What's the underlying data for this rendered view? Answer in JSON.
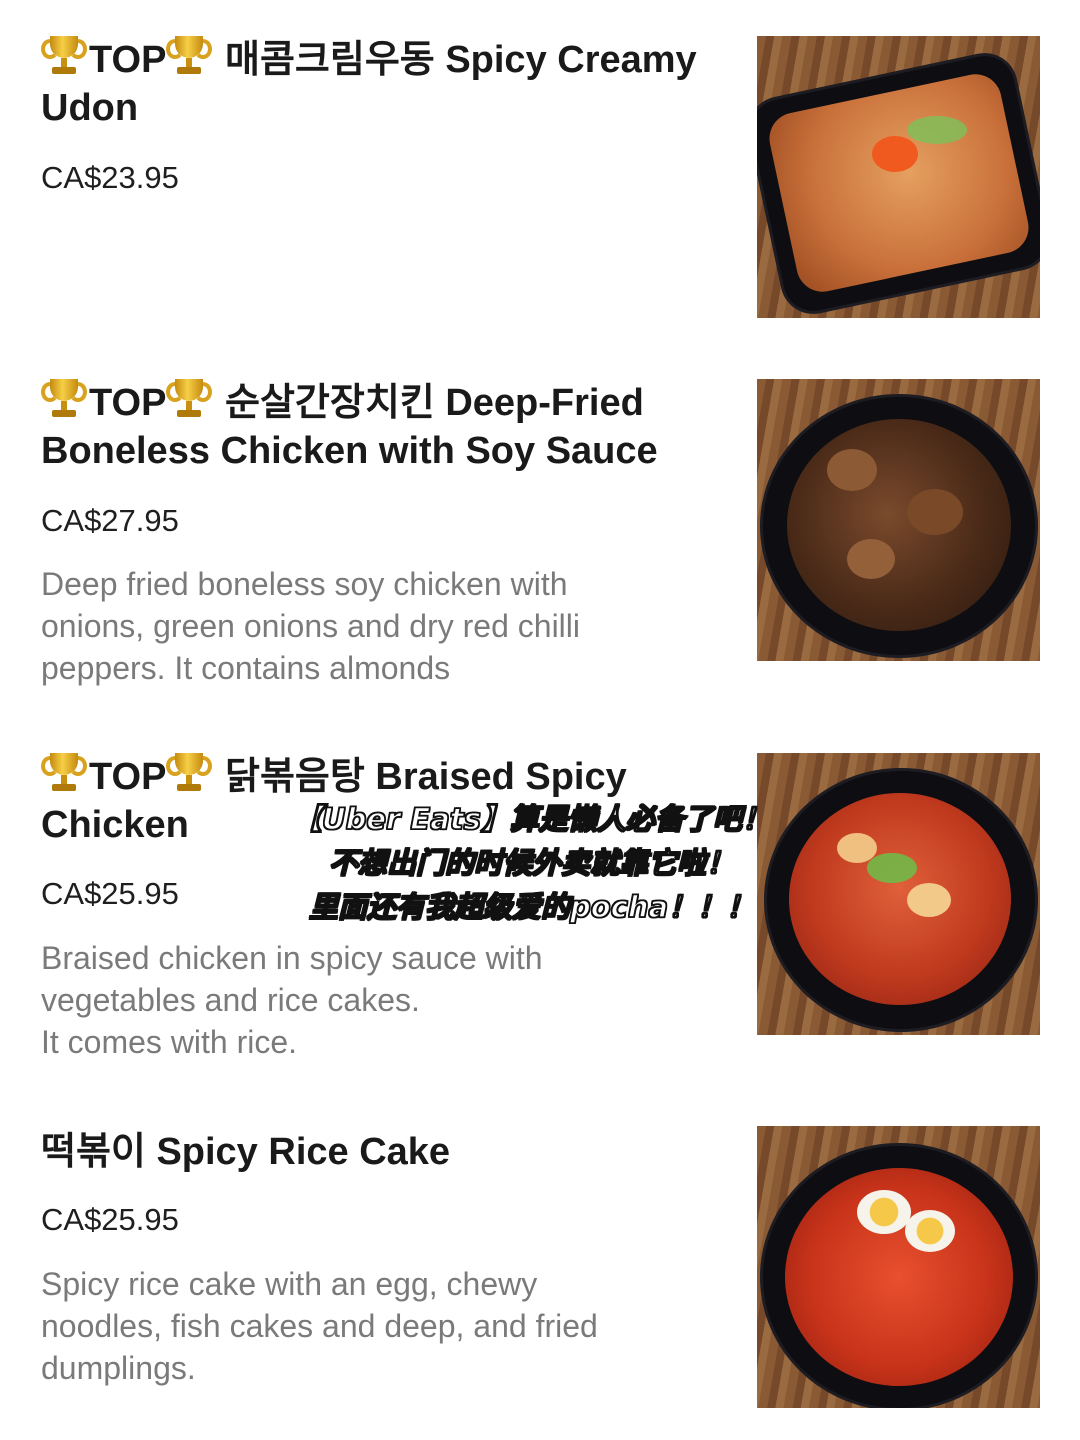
{
  "items": [
    {
      "top_badge": "TOP",
      "title": "매콤크림우동 Spicy Creamy Udon",
      "price": "CA$23.95",
      "description": "",
      "photo_icon": "spicy-creamy-udon-photo"
    },
    {
      "top_badge": "TOP",
      "title": "순살간장치킨 Deep-Fried Boneless Chicken with Soy Sauce",
      "price": "CA$27.95",
      "description": "Deep fried boneless soy chicken with\nonions, green onions and dry red chilli\npeppers. It contains almonds",
      "photo_icon": "soy-chicken-photo"
    },
    {
      "top_badge": "TOP",
      "title": "닭볶음탕 Braised Spicy Chicken",
      "price": "CA$25.95",
      "description": "Braised chicken in spicy sauce with\nvegetables and rice cakes.\nIt comes with rice.",
      "photo_icon": "braised-spicy-chicken-photo"
    },
    {
      "top_badge": "",
      "title": "떡볶이 Spicy Rice Cake",
      "price": "CA$25.95",
      "description": "Spicy rice cake with an egg, chewy\nnoodles, fish cakes and deep, and fried\ndumplings.",
      "photo_icon": "spicy-rice-cake-photo"
    }
  ],
  "overlay": {
    "line1": "【Uber Eats】算是懒人必备了吧！",
    "line2": "不想出门的时候外卖就靠它啦！",
    "line3": "里面还有我超级爱的pocha！！！"
  },
  "colors": {
    "title": "#1a1a1a",
    "description": "#7a7a7a",
    "trophy": "#f6cf46"
  }
}
